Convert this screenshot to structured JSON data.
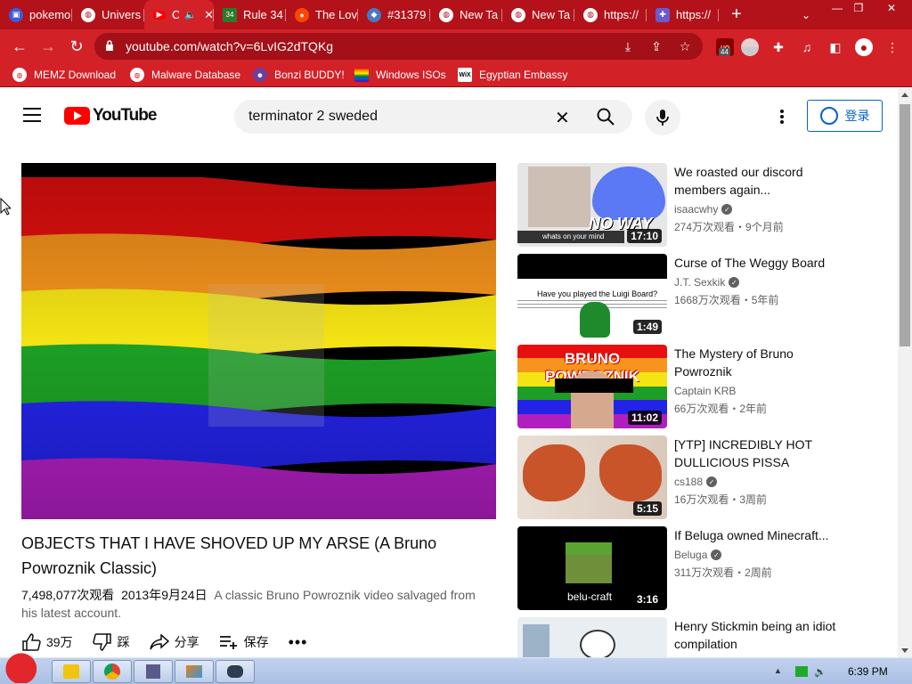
{
  "tabs": [
    {
      "title": "pokemo",
      "icon": "blue-app-icon",
      "color": "#3b5bdb"
    },
    {
      "title": "Univers",
      "icon": "globe-icon",
      "color": "#ffffff"
    },
    {
      "title": "C",
      "icon": "youtube-icon",
      "color": "#ff0000",
      "active": true
    },
    {
      "title": "Rule 34",
      "icon": "rule34-icon",
      "color": "#2b7a2b"
    },
    {
      "title": "The Lov",
      "icon": "reddit-icon",
      "color": "#ff4500"
    },
    {
      "title": "#31379",
      "icon": "site-icon",
      "color": "#4a78c2"
    },
    {
      "title": "New Ta",
      "icon": "globe-icon",
      "color": "#ffffff"
    },
    {
      "title": "New Ta",
      "icon": "globe-icon",
      "color": "#ffffff"
    },
    {
      "title": "https://",
      "icon": "globe-icon",
      "color": "#ffffff"
    },
    {
      "title": "https://",
      "icon": "puzzle-icon",
      "color": "#6a5acd"
    }
  ],
  "url": "youtube.com/watch?v=6LvIG2dTQKg",
  "ext_badge": "44",
  "bookmarks": [
    {
      "label": "MEMZ Download",
      "icon": "globe-icon"
    },
    {
      "label": "Malware Database",
      "icon": "globe-icon"
    },
    {
      "label": "Bonzi BUDDY!",
      "icon": "bonzi-icon"
    },
    {
      "label": "Windows ISOs",
      "icon": "rainbow-icon"
    },
    {
      "label": "Egyptian Embassy",
      "icon": "wix-icon",
      "mark": "WiX"
    }
  ],
  "yt": {
    "logo_text": "YouTube",
    "search_query": "terminator 2 sweded",
    "signin_label": "登录"
  },
  "video": {
    "title": "OBJECTS THAT I HAVE SHOVED UP MY ARSE (A Bruno Powroznik Classic)",
    "views": "7,498,077次观看",
    "date": "2013年9月24日",
    "description": "A classic Bruno Powroznik video salvaged from his latest account.",
    "likes": "39万",
    "dislike_label": "踩",
    "share_label": "分享",
    "save_label": "保存"
  },
  "related": [
    {
      "title": "We roasted our discord members again...",
      "channel": "isaacwhy",
      "verified": true,
      "meta": "274万次观看・9个月前",
      "duration": "17:10",
      "thumb_caption": "NO WAY",
      "thumb_caption2": "whats on your mind"
    },
    {
      "title": "Curse of The Weggy Board",
      "channel": "J.T. Sexkik",
      "verified": true,
      "meta": "1668万次观看・5年前",
      "duration": "1:49",
      "thumb_caption": "Have you played the Luigi Board?"
    },
    {
      "title": "The Mystery of Bruno Powroznik",
      "channel": "Captain KRB",
      "verified": false,
      "meta": "66万次观看・2年前",
      "duration": "11:02",
      "thumb_caption": "BRUNO POWROZNIK"
    },
    {
      "title": "[YTP] INCREDIBLY HOT DULLICIOUS PISSA",
      "channel": "cs188",
      "verified": true,
      "meta": "16万次观看・3周前",
      "duration": "5:15"
    },
    {
      "title": "If Beluga owned Minecraft...",
      "channel": "Beluga",
      "verified": true,
      "meta": "311万次观看・2周前",
      "duration": "3:16",
      "thumb_caption": "belu-craft"
    },
    {
      "title": "Henry Stickmin being an idiot compilation",
      "channel": "",
      "verified": false,
      "meta": "",
      "duration": ""
    }
  ],
  "taskbar": {
    "clock": "6:39 PM"
  }
}
